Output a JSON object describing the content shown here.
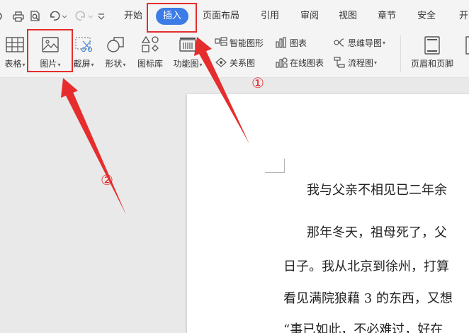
{
  "menubar": {
    "items": [
      {
        "label": "开始"
      },
      {
        "label": "插入"
      },
      {
        "label": "页面布局"
      },
      {
        "label": "引用"
      },
      {
        "label": "审阅"
      },
      {
        "label": "视图"
      },
      {
        "label": "章节"
      },
      {
        "label": "安全"
      },
      {
        "label": "开"
      }
    ]
  },
  "ribbon": {
    "table": "表格",
    "picture": "图片",
    "screenshot": "截屏",
    "shape": "形状",
    "icon_library": "图标库",
    "function_chart": "功能图",
    "smart_graphic": "智能图形",
    "chart": "图表",
    "mind_map": "思维导图",
    "relation_chart": "关系图",
    "online_chart": "在线图表",
    "flowchart": "流程图",
    "header_footer": "页眉和页脚"
  },
  "annotations": {
    "step1": "①",
    "step2": "②"
  },
  "document": {
    "lines": [
      "我与父亲不相见已二年余",
      "那年冬天，祖母死了，父",
      "日子。我从北京到徐州，打算",
      "看见满院狼藉 3 的东西，又想",
      "“事已如此，不必难过，好在"
    ]
  },
  "colors": {
    "accent": "#3d7ce6",
    "annotation_red": "#e52d2d"
  }
}
